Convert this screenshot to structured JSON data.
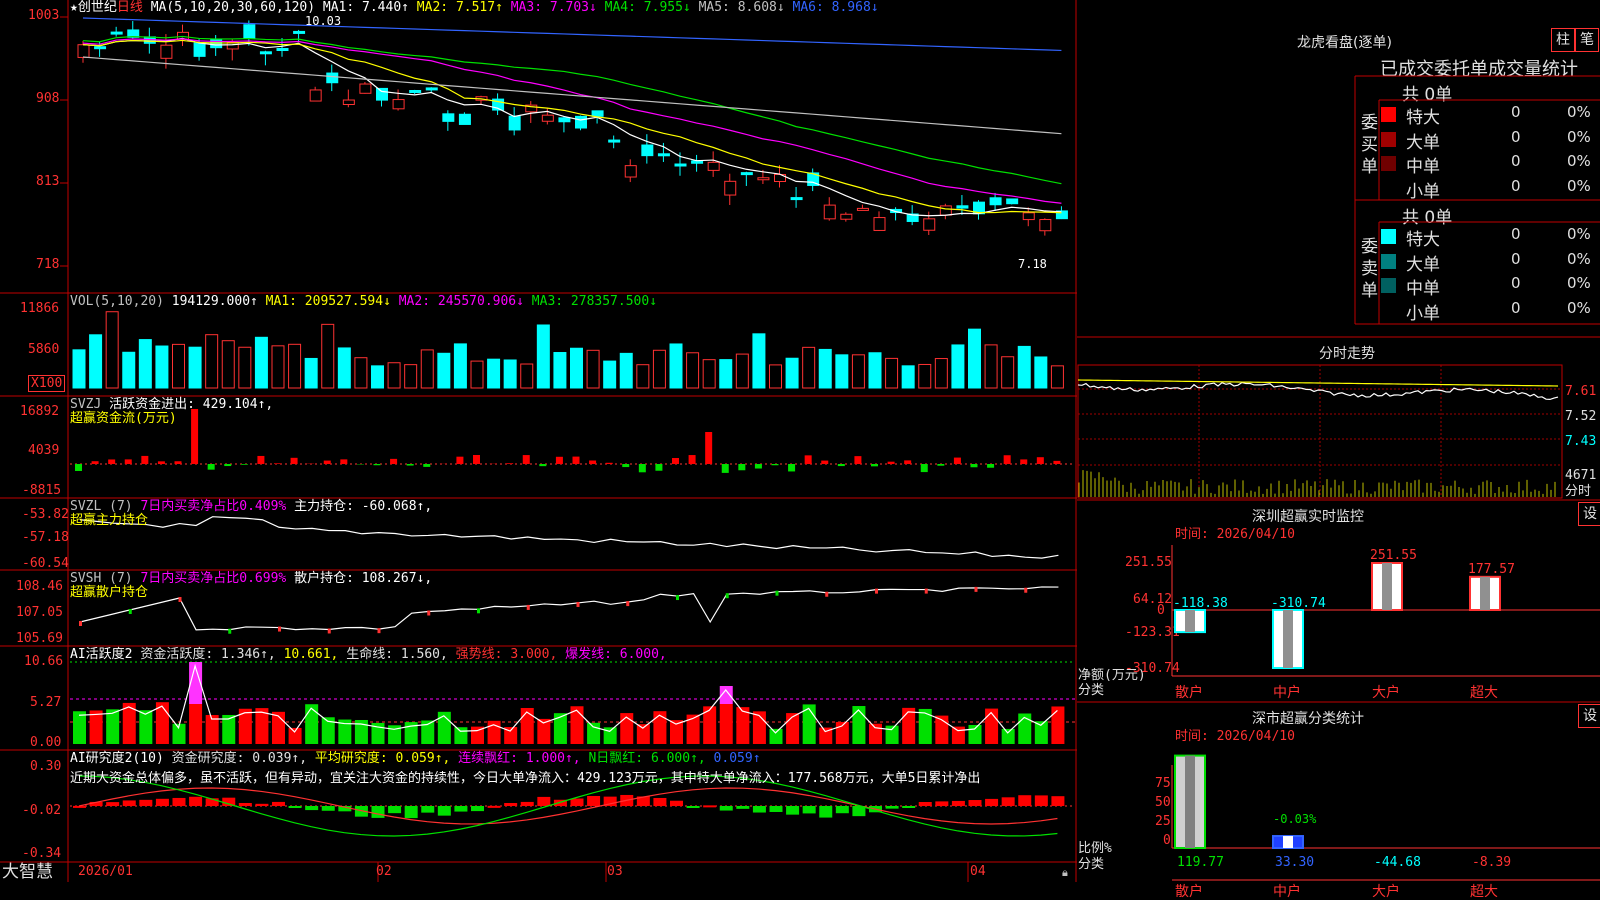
{
  "stock_name": "创世纪",
  "period": "日线",
  "ma_line": {
    "label": "MA(5,10,20,30,60,120)",
    "items": [
      {
        "text": "MA1: 7.440↑",
        "color": "#ffffff"
      },
      {
        "text": "MA2: 7.517↑",
        "color": "#ffff00"
      },
      {
        "text": "MA3: 7.703↓",
        "color": "#ff00ff"
      },
      {
        "text": "MA4: 7.955↓",
        "color": "#00e000"
      },
      {
        "text": "MA5: 8.608↓",
        "color": "#c0c0c0"
      },
      {
        "text": "MA6: 8.968↓",
        "color": "#3264ff"
      }
    ]
  },
  "price_axis": [
    "1003",
    "908",
    "813",
    "718"
  ],
  "price_high_note": "10.03",
  "price_low_note": "7.18",
  "vol_line": {
    "label": "VOL(5,10,20)",
    "value": "194129.000↑",
    "items": [
      {
        "text": "MA1: 209527.594↓",
        "color": "#ffff00"
      },
      {
        "text": "MA2: 245570.906↓",
        "color": "#ff00ff"
      },
      {
        "text": "MA3: 278357.500↓",
        "color": "#00e000"
      }
    ]
  },
  "vol_axis": [
    "11866",
    "5860"
  ],
  "vol_unit": "X100",
  "svzj": {
    "label": "SVZJ",
    "text": "活跃资金进出: 429.104↑,",
    "sub": "超赢资金流(万元)",
    "axis": [
      "16892",
      "4039",
      "-8815"
    ]
  },
  "svzl": {
    "label": "SVZL (7)",
    "ratio": "7日内买卖净占比0.409%",
    "hold": "主力持仓: -60.068↑,",
    "sub": "超赢主力持仓",
    "axis": [
      "-53.82",
      "-57.18",
      "-60.54"
    ]
  },
  "svsh": {
    "label": "SVSH (7)",
    "ratio": "7日内买卖净占比0.699%",
    "hold": "散户持仓: 108.267↓,",
    "sub": "超赢散户持仓",
    "axis": [
      "108.46",
      "107.05",
      "105.69"
    ]
  },
  "ai_active": {
    "label": "AI活跃度2",
    "items": [
      {
        "text": "资金活跃度: 1.346↑,",
        "color": "#e0e0e0"
      },
      {
        "text": "10.661,",
        "color": "#ffff00"
      },
      {
        "text": "生命线: 1.560,",
        "color": "#e0e0e0"
      },
      {
        "text": "强势线: 3.000,",
        "color": "#ff3232"
      },
      {
        "text": "爆发线: 6.000,",
        "color": "#ff00ff"
      }
    ],
    "axis": [
      "10.66",
      "5.27",
      "0.00"
    ]
  },
  "ai_research": {
    "label": "AI研究度2(10)",
    "items": [
      {
        "text": "资金研究度: 0.039↑,",
        "color": "#e0e0e0"
      },
      {
        "text": "平均研究度: 0.059↑,",
        "color": "#ffff00"
      },
      {
        "text": "连续飘红: 1.000↑,",
        "color": "#ff00ff"
      },
      {
        "text": "N日飘红: 6.000↑,",
        "color": "#00e000"
      },
      {
        "text": "0.059↑",
        "color": "#3264ff"
      }
    ],
    "axis": [
      "0.30",
      "-0.02",
      "-0.34"
    ],
    "comment": "近期大资金总体偏多，虽不活跃，但有异动，宜关注大资金的持续性，今日大单净流入：429.123万元，其中特大单净流入：177.568万元，大单5日累计净出"
  },
  "date_axis": [
    "2026/01",
    "02",
    "03",
    "04"
  ],
  "brand": "大智慧",
  "dragon": {
    "title": "龙虎看盘(逐单)",
    "btn1": "柱",
    "btn2": "笔",
    "header": "已成交委托单成交量统计",
    "buy_label": "委买单",
    "sell_label": "委卖单",
    "buy_total": "共 0单",
    "sell_total": "共 0单",
    "buy_rows": [
      {
        "name": "特大",
        "count": "0",
        "pct": "0%",
        "color": "#ff0000"
      },
      {
        "name": "大单",
        "count": "0",
        "pct": "0%",
        "color": "#a00000"
      },
      {
        "name": "中单",
        "count": "0",
        "pct": "0%",
        "color": "#700000"
      },
      {
        "name": "小单",
        "count": "0",
        "pct": "0%",
        "color": ""
      }
    ],
    "sell_rows": [
      {
        "name": "特大",
        "count": "0",
        "pct": "0%",
        "color": "#00ffff"
      },
      {
        "name": "大单",
        "count": "0",
        "pct": "0%",
        "color": "#008080"
      },
      {
        "name": "中单",
        "count": "0",
        "pct": "0%",
        "color": "#006060"
      },
      {
        "name": "小单",
        "count": "0",
        "pct": "0%",
        "color": ""
      }
    ]
  },
  "intraday": {
    "title": "分时走势",
    "axis": [
      "7.61",
      "7.52",
      "7.43"
    ],
    "vol_value": "4671",
    "vol_unit": "分时"
  },
  "sz_monitor": {
    "title": "深圳超赢实时监控",
    "btn": "设",
    "time": "时间: 2026/04/10",
    "axis": [
      "251.55",
      "64.12",
      "0",
      "-123.31",
      "-310.74"
    ],
    "ylabel": "净额(万元)",
    "xlabel": "分类",
    "chart_data": {
      "type": "bar",
      "categories": [
        "散户",
        "中户",
        "大户",
        "超大"
      ],
      "values": [
        -118.38,
        -310.74,
        251.55,
        177.57
      ],
      "value_labels": [
        "-118.38",
        "-310.74",
        "251.55",
        "177.57"
      ],
      "ylim": [
        -310.74,
        251.55
      ]
    }
  },
  "sz_class": {
    "title": "深市超赢分类统计",
    "btn": "设",
    "time": "时间: 2026/04/10",
    "axis": [
      "75",
      "50",
      "25",
      "0"
    ],
    "ylabel": "比例%",
    "xlabel": "分类",
    "chart_data": {
      "type": "bar",
      "categories": [
        "散户",
        "中户",
        "大户",
        "超大"
      ],
      "values": [
        119.77,
        33.3,
        -44.68,
        -8.39
      ],
      "value_labels": [
        "119.77",
        "33.30",
        "-44.68",
        "-8.39"
      ],
      "annotation": "-0.03%",
      "ylim": [
        0,
        90
      ]
    }
  }
}
